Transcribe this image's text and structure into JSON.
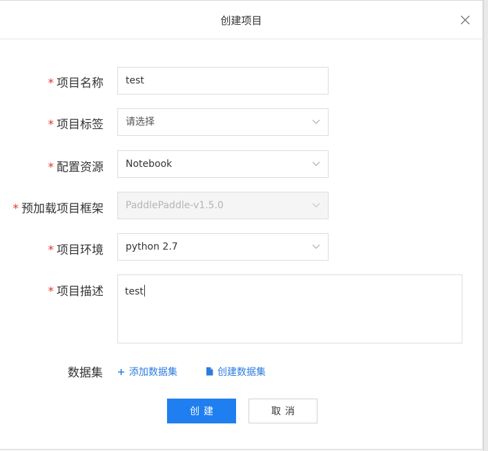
{
  "dialog": {
    "title": "创建项目"
  },
  "form": {
    "required_mark": "*",
    "project_name": {
      "label": "项目名称",
      "value": "test"
    },
    "project_tag": {
      "label": "项目标签",
      "value": "请选择"
    },
    "resource": {
      "label": "配置资源",
      "value": "Notebook"
    },
    "framework": {
      "label": "预加载项目框架",
      "value": "PaddlePaddle-v1.5.0"
    },
    "environment": {
      "label": "项目环境",
      "value": "python 2.7"
    },
    "description": {
      "label": "项目描述",
      "value": "test"
    },
    "dataset": {
      "label": "数据集",
      "add_link": "添加数据集",
      "create_link": "创建数据集"
    }
  },
  "buttons": {
    "create": "创建",
    "cancel": "取消"
  },
  "colors": {
    "primary": "#1f7ef0",
    "link": "#2b7cdd",
    "required": "#e0362c"
  }
}
